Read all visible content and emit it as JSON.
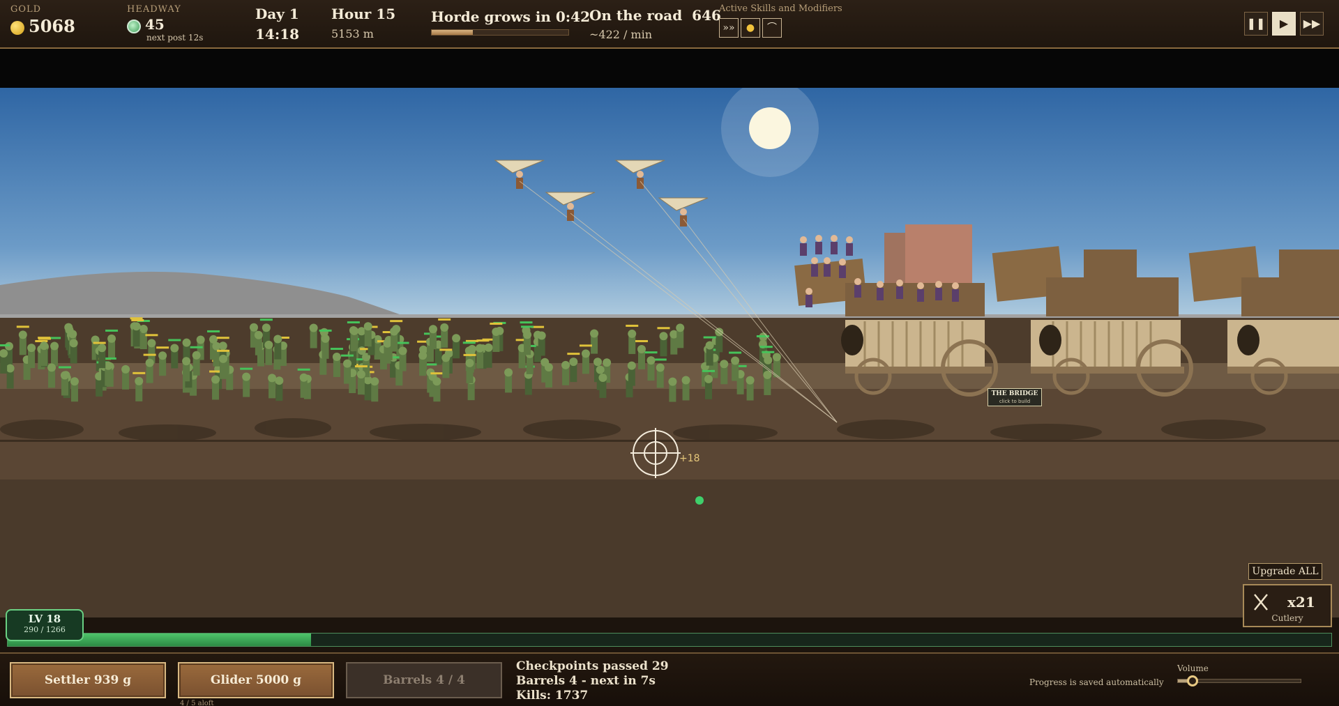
{
  "top": {
    "gold_label": "GOLD",
    "gold_value": "5068",
    "headway_label": "HEADWAY",
    "headway_value": "45",
    "headway_next": "next post 12s",
    "day": "Day 1",
    "clock": "14:18",
    "hour": "Hour 15",
    "distance": "5153 m",
    "horde_text": "Horde grows in 0:42",
    "horde_progress": 0.3,
    "road_label": "On the road",
    "road_value": "646",
    "rate": "~422 / min",
    "skills_label": "Active Skills and Modifiers",
    "skills": [
      {
        "name": "speed-chevrons-icon",
        "glyph": "»»"
      },
      {
        "name": "gold-coin-icon",
        "glyph": "●"
      },
      {
        "name": "arc-jump-icon",
        "glyph": "⌒"
      }
    ]
  },
  "controls": {
    "pause_icon": "pause-icon",
    "play_icon": "play-icon",
    "fast_forward_icon": "fast-forward-icon",
    "active": "play"
  },
  "scene": {
    "bridge_title": "THE BRIDGE",
    "bridge_sub": "click to build",
    "damage_text": "+18"
  },
  "level": {
    "label": "LV 18",
    "xp_text": "290 / 1266",
    "xp_fraction": 0.229
  },
  "upgrades": {
    "upgrade_all_label": "Upgrade ALL",
    "cutlery_count": "x21",
    "cutlery_name": "Cutlery"
  },
  "bottom": {
    "settler_label": "Settler  939 g",
    "glider_label": "Glider  5000 g",
    "glider_sub": "4 / 5 aloft",
    "barrels_label": "Barrels  4 / 4",
    "checkpoints": "Checkpoints passed  29",
    "barrels_status": "Barrels 4  -  next in 7s",
    "kills": "Kills: 1737",
    "autosave": "Progress is saved automatically",
    "volume_label": "Volume",
    "volume_level": 0.12
  },
  "colors": {
    "accent_gold": "#d4a016",
    "xp_green": "#4fc46a",
    "frame_brown": "#8a6a3e"
  }
}
